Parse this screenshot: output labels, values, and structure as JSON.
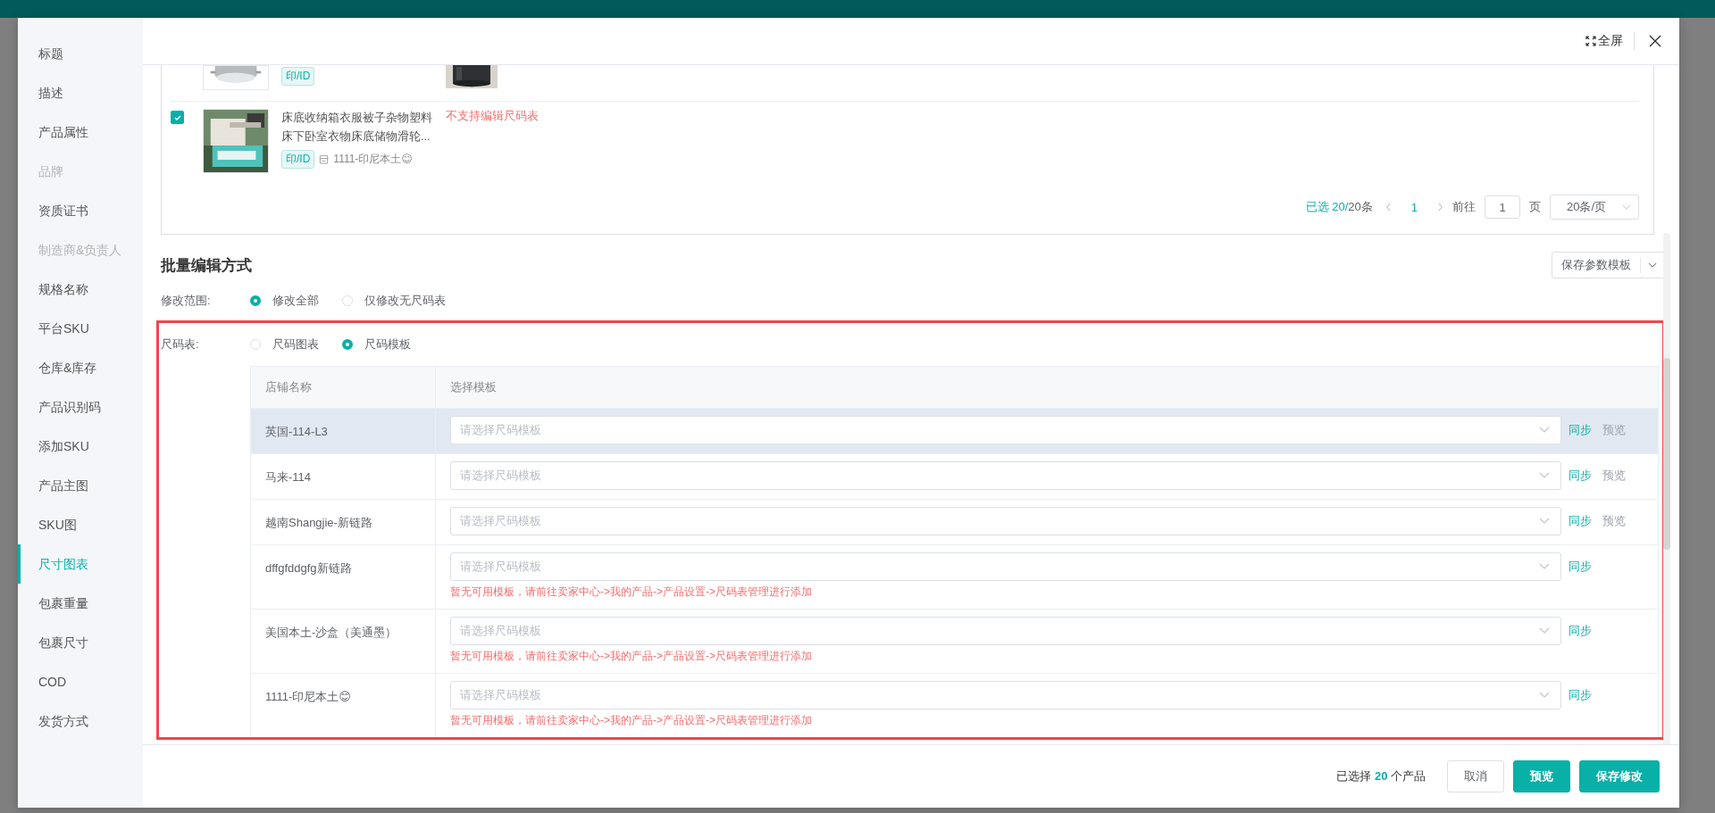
{
  "sidebar": {
    "items": [
      {
        "label": "标题",
        "selected": false,
        "disabled": false
      },
      {
        "label": "描述",
        "selected": false,
        "disabled": false
      },
      {
        "label": "产品属性",
        "selected": false,
        "disabled": false
      },
      {
        "label": "品牌",
        "selected": false,
        "disabled": true
      },
      {
        "label": "资质证书",
        "selected": false,
        "disabled": false
      },
      {
        "label": "制造商&负责人",
        "selected": false,
        "disabled": true
      },
      {
        "label": "规格名称",
        "selected": false,
        "disabled": false
      },
      {
        "label": "平台SKU",
        "selected": false,
        "disabled": false
      },
      {
        "label": "仓库&库存",
        "selected": false,
        "disabled": false
      },
      {
        "label": "产品识别码",
        "selected": false,
        "disabled": false
      },
      {
        "label": "添加SKU",
        "selected": false,
        "disabled": false
      },
      {
        "label": "产品主图",
        "selected": false,
        "disabled": false
      },
      {
        "label": "SKU图",
        "selected": false,
        "disabled": false
      },
      {
        "label": "尺寸图表",
        "selected": true,
        "disabled": false
      },
      {
        "label": "包裹重量",
        "selected": false,
        "disabled": false
      },
      {
        "label": "包裹尺寸",
        "selected": false,
        "disabled": false
      },
      {
        "label": "COD",
        "selected": false,
        "disabled": false
      },
      {
        "label": "发货方式",
        "selected": false,
        "disabled": false
      }
    ]
  },
  "header": {
    "fullscreen": "全屏"
  },
  "product_rows": [
    {
      "tag": "印/ID"
    },
    {
      "checked": true,
      "title": "床底收纳箱衣服被子杂物塑料床下卧室衣物床底储物滑轮...",
      "tag": "印/ID",
      "store": "1111-印尼本土😊",
      "note": "不支持编辑尺码表"
    }
  ],
  "pagination": {
    "selected": "已选 20/",
    "total": "20条",
    "page": "1",
    "goto_label": "前往",
    "goto_value": "1",
    "page_unit": "页",
    "page_size": "20条/页"
  },
  "batch_edit": {
    "title": "批量编辑方式",
    "save_template": "保存参数模板",
    "scope": {
      "label": "修改范围:",
      "options": [
        {
          "label": "修改全部",
          "selected": true
        },
        {
          "label": "仅修改无尺码表",
          "selected": false
        }
      ]
    },
    "size_chart": {
      "label": "尺码表:",
      "options": [
        {
          "label": "尺码图表",
          "selected": false
        },
        {
          "label": "尺码模板",
          "selected": true
        }
      ]
    },
    "table": {
      "columns": [
        "店铺名称",
        "选择模板"
      ],
      "rows": [
        {
          "store": "英国-114-L3",
          "placeholder": "请选择尺码模板",
          "sync": "同步",
          "preview": "预览",
          "highlighted": true
        },
        {
          "store": "马来-114",
          "placeholder": "请选择尺码模板",
          "sync": "同步",
          "preview": "预览",
          "highlighted": false
        },
        {
          "store": "越南Shangjie-新链路",
          "placeholder": "请选择尺码模板",
          "sync": "同步",
          "preview": "预览",
          "highlighted": false
        },
        {
          "store": "dffgfddgfg新链路",
          "placeholder": "请选择尺码模板",
          "sync": "同步",
          "error": "暂无可用模板，请前往卖家中心->我的产品->产品设置->尺码表管理进行添加",
          "highlighted": false
        },
        {
          "store": "美国本土-沙盒（美通墨）",
          "placeholder": "请选择尺码模板",
          "sync": "同步",
          "error": "暂无可用模板，请前往卖家中心->我的产品->产品设置->尺码表管理进行添加",
          "highlighted": false
        },
        {
          "store": "1111-印尼本土😊",
          "placeholder": "请选择尺码模板",
          "sync": "同步",
          "error": "暂无可用模板，请前往卖家中心->我的产品->产品设置->尺码表管理进行添加",
          "highlighted": false
        }
      ]
    }
  },
  "footer": {
    "selected_prefix": "已选择",
    "count": "20",
    "selected_suffix": "个产品",
    "buttons": [
      {
        "label": "取消",
        "kind": "default"
      },
      {
        "label": "预览",
        "kind": "primary"
      },
      {
        "label": "保存修改",
        "kind": "primary"
      }
    ]
  }
}
